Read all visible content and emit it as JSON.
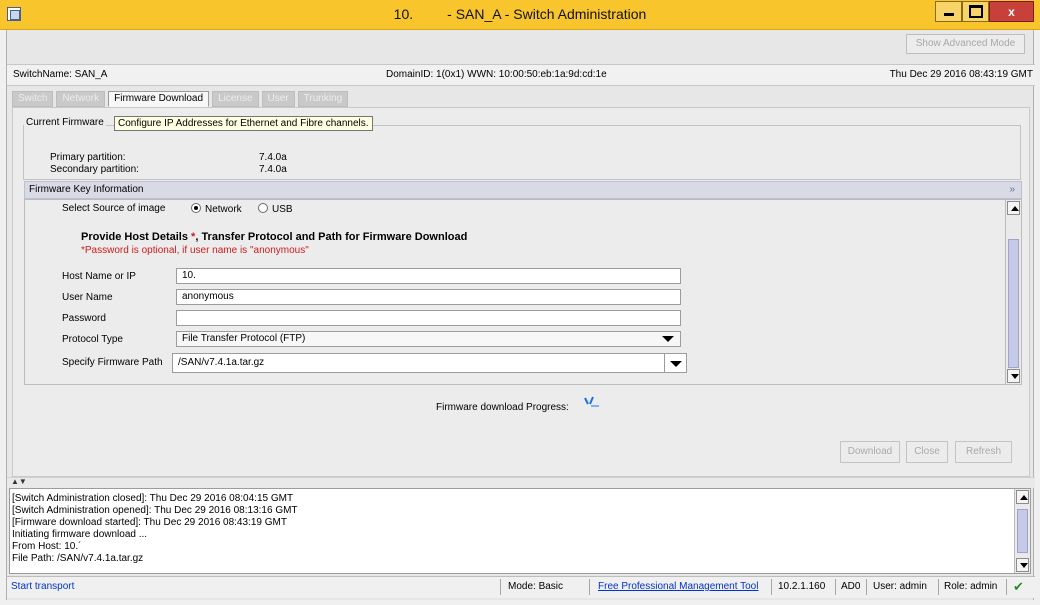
{
  "window": {
    "title_ip": "10.",
    "title_name": "- SAN_A - Switch Administration"
  },
  "toolbar": {
    "advanced_mode_label": "Show Advanced Mode"
  },
  "info_bar": {
    "switch_name": "SwitchName: SAN_A",
    "domain_wwn": "DomainID: 1(0x1)    WWN: 10:00:50:eb:1a:9d:cd:1e",
    "datetime": "Thu Dec 29 2016 08:43:19 GMT"
  },
  "tabs": [
    {
      "label": "Switch",
      "active": false
    },
    {
      "label": "Network",
      "active": false
    },
    {
      "label": "Firmware Download",
      "active": true
    },
    {
      "label": "License",
      "active": false
    },
    {
      "label": "User",
      "active": false
    },
    {
      "label": "Trunking",
      "active": false
    }
  ],
  "current_firmware": {
    "legend": "Current Firmware",
    "tooltip": "Configure IP Addresses for Ethernet and Fibre channels.",
    "primary_label": "Primary partition:",
    "primary_value": "7.4.0a",
    "secondary_label": "Secondary partition:",
    "secondary_value": "7.4.0a"
  },
  "firmware_key": {
    "header": "Firmware Key Information",
    "source_label": "Select Source of image",
    "source_network": "Network",
    "source_usb": "USB",
    "heading": "Provide Host Details",
    "asterisk": "*",
    "heading_rest": ", Transfer Protocol and Path for Firmware Download",
    "note": "*Password is optional, if user name is \"anonymous\"",
    "host_label": "Host Name or IP",
    "host_value": "10.",
    "user_label": "User Name",
    "user_value": "anonymous",
    "password_label": "Password",
    "password_value": "",
    "protocol_label": "Protocol Type",
    "protocol_value": "File Transfer Protocol (FTP)",
    "path_label": "Specify Firmware Path",
    "path_value": "/SAN/v7.4.1a.tar.gz"
  },
  "progress": {
    "label": "Firmware download Progress:"
  },
  "actions": {
    "download": "Download",
    "close": "Close",
    "refresh": "Refresh"
  },
  "log": [
    "[Switch Administration closed]: Thu Dec 29 2016 08:04:15 GMT",
    "[Switch Administration opened]: Thu Dec 29 2016 08:13:16 GMT",
    "[Firmware download started]: Thu Dec 29 2016 08:43:19 GMT",
    "Initiating firmware download ...",
    "From Host: 10.´",
    "File Path: /SAN/v7.4.1a.tar.gz"
  ],
  "status": {
    "transport": "Start transport",
    "mode": "Mode: Basic",
    "tool": "Free Professional Management Tool",
    "ip": "10.2.1.160",
    "ad": "AD0",
    "user": "User: admin",
    "role": "Role: admin"
  },
  "colors": {
    "title_bar": "#f9c52c",
    "link": "#0033cc",
    "required": "#d11a1a",
    "ok_check": "#2c8a2c"
  }
}
